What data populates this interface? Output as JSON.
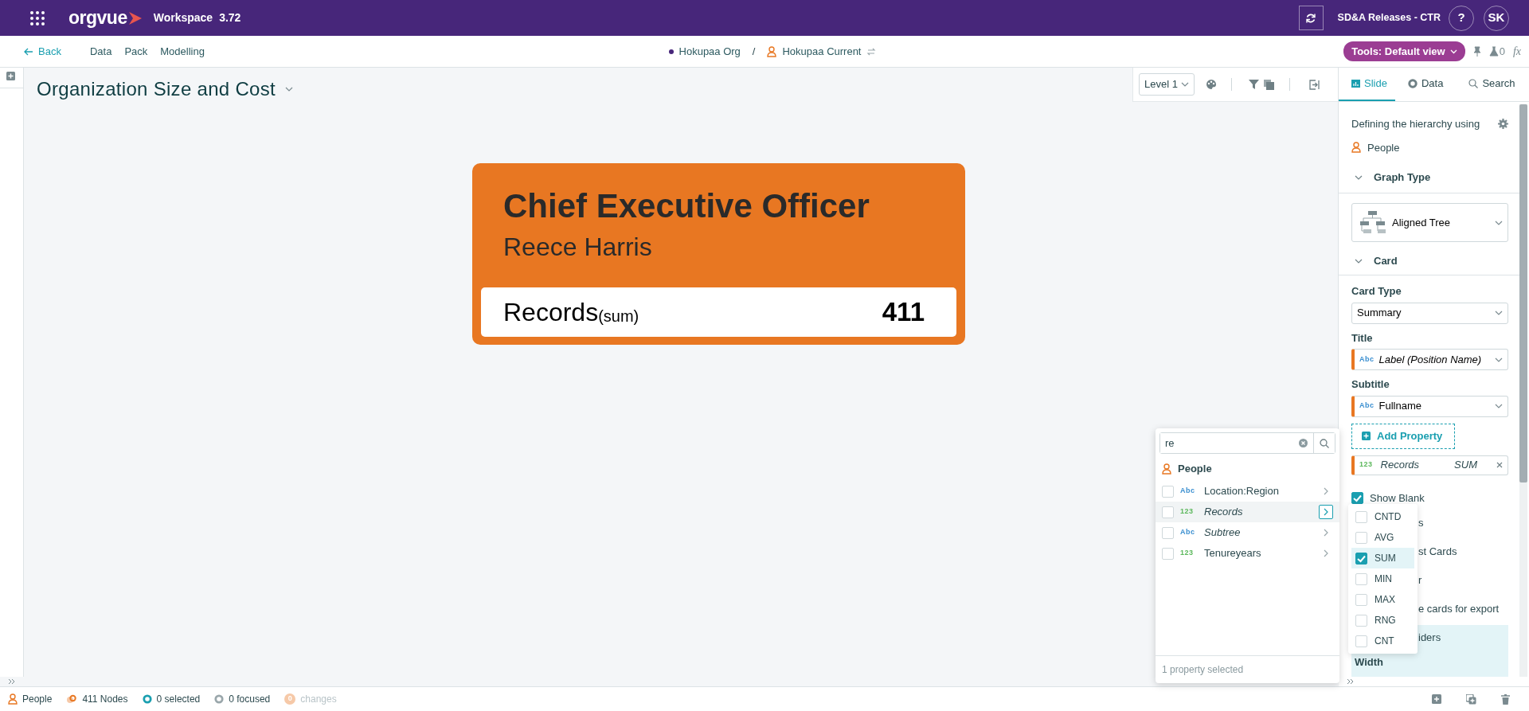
{
  "top_bar": {
    "logo": "orgvue",
    "product": "Workspace",
    "version": "3.72",
    "project": "SD&A Releases - CTR",
    "help": "?",
    "user_initials": "SK"
  },
  "nav": {
    "back": "Back",
    "links": [
      "Data",
      "Pack",
      "Modelling"
    ],
    "breadcrumb": [
      {
        "kind": "org",
        "label": "Hokupaa Org"
      },
      {
        "kind": "people",
        "label": "Hokupaa Current"
      }
    ],
    "separator": "/",
    "tools": "Tools: Default view",
    "flask_count": "0",
    "formula": "fx"
  },
  "canvas": {
    "title": "Organization Size and Cost",
    "level": "Level 1",
    "card": {
      "title": "Chief Executive Officer",
      "subtitle": "Reece Harris",
      "metric": "Records",
      "aggregation": "(sum)",
      "value": "411"
    }
  },
  "panel": {
    "tabs": [
      {
        "kind": "chart",
        "label": "Slide",
        "selected": true
      },
      {
        "kind": "data",
        "label": "Data",
        "selected": false
      },
      {
        "kind": "search",
        "label": "Search",
        "selected": false
      }
    ],
    "hierarchy_label": "Defining the hierarchy using",
    "hierarchy_source": "People",
    "graph_type": {
      "title": "Graph Type",
      "expanded": true,
      "value": "Aligned Tree"
    },
    "card": {
      "title": "Card",
      "expanded": true,
      "card_type_label": "Card Type",
      "card_type": "Summary",
      "title_label": "Title",
      "title_value": {
        "kind": "text",
        "type": "Abc",
        "label": "Label (Position Name)",
        "derived": true
      },
      "subtitle_label": "Subtitle",
      "subtitle_value": {
        "kind": "text",
        "type": "Abc",
        "label": "Fullname",
        "derived": false
      },
      "add_property": "Add Property",
      "properties": [
        {
          "kind": "number",
          "type": "123",
          "label": "Records",
          "aggregation": "SUM",
          "derived": true
        }
      ]
    },
    "options": [
      {
        "kind": "checkbox",
        "label": "Show Blank",
        "checked": true
      },
      {
        "kind": "text",
        "label": "s"
      },
      {
        "kind": "text",
        "label": "st Cards"
      },
      {
        "kind": "text",
        "label": "r"
      },
      {
        "kind": "text",
        "label": "e cards for export"
      },
      {
        "kind": "highlight",
        "label": "iders"
      },
      {
        "kind": "highlight",
        "label": "Width"
      }
    ]
  },
  "popover": {
    "search": "re",
    "group": "People",
    "items": [
      {
        "kind": "text",
        "type": "Abc",
        "label": "Location:Region",
        "derived": false,
        "checked": false,
        "selected": false
      },
      {
        "kind": "number",
        "type": "123",
        "label": "Records",
        "derived": true,
        "checked": false,
        "selected": true
      },
      {
        "kind": "text",
        "type": "Abc",
        "label": "Subtree",
        "derived": true,
        "checked": false,
        "selected": false
      },
      {
        "kind": "number",
        "type": "123",
        "label": "Tenureyears",
        "derived": false,
        "checked": false,
        "selected": false
      }
    ],
    "footer": "1 property selected"
  },
  "submenu": {
    "options": [
      {
        "label": "CNTD",
        "checked": false,
        "selected": false
      },
      {
        "label": "AVG",
        "checked": false,
        "selected": false
      },
      {
        "label": "SUM",
        "checked": true,
        "selected": true
      },
      {
        "label": "MIN",
        "checked": false,
        "selected": false
      },
      {
        "label": "MAX",
        "checked": false,
        "selected": false
      },
      {
        "label": "RNG",
        "checked": false,
        "selected": false
      },
      {
        "label": "CNT",
        "checked": false,
        "selected": false
      }
    ]
  },
  "status_bar": [
    {
      "kind": "people",
      "label": "People",
      "disabled": false
    },
    {
      "kind": "nodes",
      "label": "411 Nodes",
      "disabled": false
    },
    {
      "kind": "selected",
      "label": "0 selected",
      "disabled": false
    },
    {
      "kind": "focused",
      "label": "0 focused",
      "disabled": false
    },
    {
      "kind": "changes",
      "count": "0",
      "label": "changes",
      "disabled": true
    }
  ]
}
